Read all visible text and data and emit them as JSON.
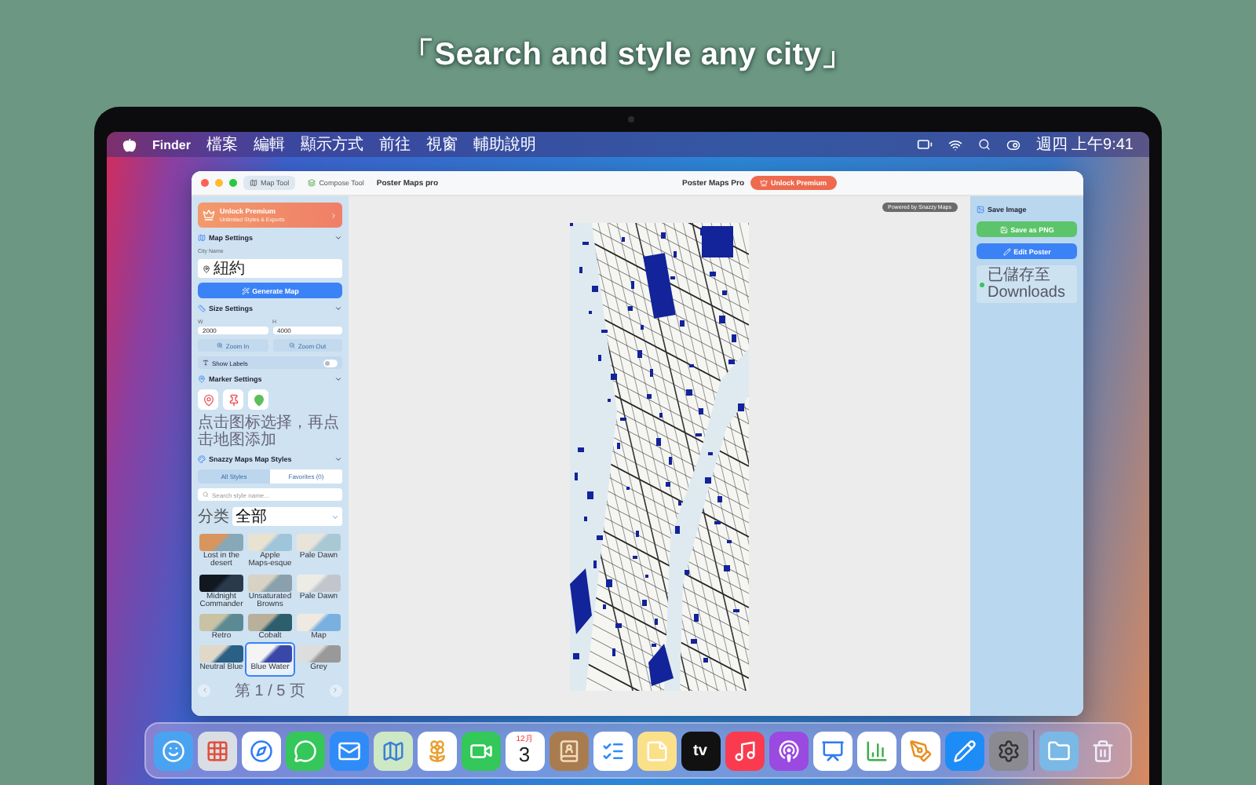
{
  "headline": "「Search and style any city」",
  "menubar": {
    "items": [
      "Finder",
      "檔案",
      "編輯",
      "顯示方式",
      "前往",
      "視窗",
      "輔助說明"
    ],
    "clock": "週四 上午9:41"
  },
  "window": {
    "tabs": [
      {
        "label": "Map Tool",
        "selected": true
      },
      {
        "label": "Compose Tool",
        "selected": false
      }
    ],
    "title": "Poster Maps pro",
    "app_name": "Poster Maps Pro",
    "unlock_button": "Unlock Premium"
  },
  "sidebar": {
    "promo": {
      "title": "Unlock Premium",
      "subtitle": "Unlimited Styles & Exports"
    },
    "map_settings": {
      "title": "Map Settings",
      "city_label": "City Name",
      "city_value": "紐約",
      "generate_button": "Generate Map"
    },
    "size_settings": {
      "title": "Size Settings",
      "width_label": "W",
      "width_value": "2000",
      "height_label": "H",
      "height_value": "4000",
      "zoom_in": "Zoom In",
      "zoom_out": "Zoom Out",
      "show_labels": "Show Labels",
      "show_labels_on": false
    },
    "marker_settings": {
      "title": "Marker Settings",
      "hint": "点击图标选择，再点击地图添加"
    },
    "styles": {
      "title": "Snazzy Maps Map Styles",
      "tabs": [
        {
          "label": "All Styles",
          "selected": true
        },
        {
          "label": "Favorites (0)",
          "selected": false
        }
      ],
      "search_placeholder": "Search style name...",
      "category_label": "分类",
      "category_value": "全部",
      "items": [
        {
          "name": "Lost in the desert",
          "selected": false
        },
        {
          "name": "Apple Maps-esque",
          "selected": false
        },
        {
          "name": "Pale Dawn",
          "selected": false
        },
        {
          "name": "Midnight Commander",
          "selected": false
        },
        {
          "name": "Unsaturated Browns",
          "selected": false
        },
        {
          "name": "Pale Dawn",
          "selected": false
        },
        {
          "name": "Retro",
          "selected": false
        },
        {
          "name": "Cobalt",
          "selected": false
        },
        {
          "name": "Map",
          "selected": false
        },
        {
          "name": "Neutral Blue",
          "selected": false
        },
        {
          "name": "Blue Water",
          "selected": true
        },
        {
          "name": "Grey",
          "selected": false
        }
      ],
      "page": "第 1 / 5 页"
    }
  },
  "canvas": {
    "badge": "Powered by Snazzy Maps"
  },
  "right_panel": {
    "title": "Save Image",
    "save_button": "Save as PNG",
    "edit_button": "Edit Poster",
    "status": "已儲存至 Downloads"
  },
  "dock": {
    "calendar_month": "12月",
    "calendar_day": "3",
    "tv_label": "tv"
  }
}
